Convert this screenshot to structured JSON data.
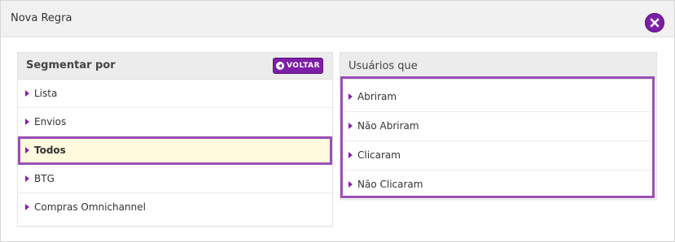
{
  "dialog": {
    "title": "Nova Regra",
    "close_icon": "close-icon",
    "accent_color": "#7d1fa6"
  },
  "left_panel": {
    "title": "Segmentar por",
    "back_button": "VOLTAR",
    "items": [
      {
        "label": "Lista"
      },
      {
        "label": "Envios"
      },
      {
        "label": "Todos",
        "selected": true
      },
      {
        "label": "BTG"
      },
      {
        "label": "Compras Omnichannel"
      }
    ]
  },
  "right_panel": {
    "title": "Usuários que",
    "items": [
      {
        "label": "Abriram"
      },
      {
        "label": "Não Abriram"
      },
      {
        "label": "Clicaram"
      },
      {
        "label": "Não Clicaram"
      }
    ]
  }
}
